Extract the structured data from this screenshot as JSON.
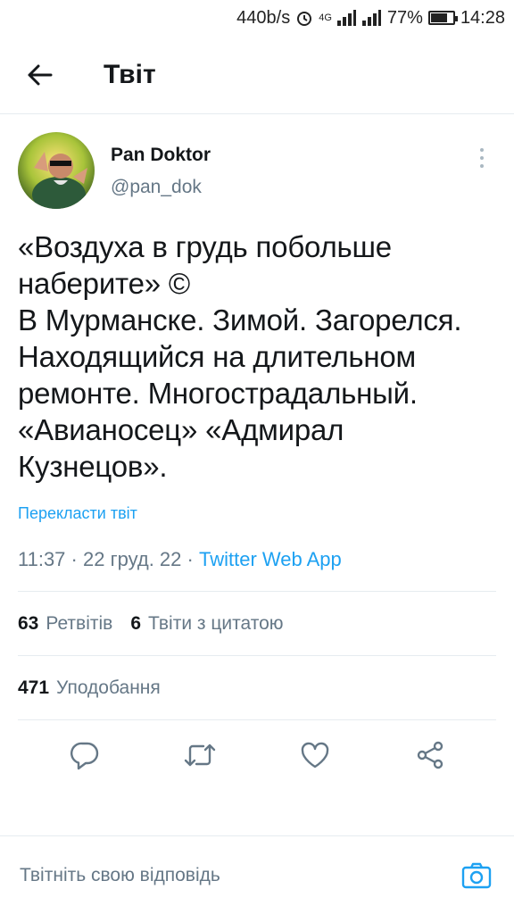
{
  "status_bar": {
    "speed": "440b/s",
    "network": "4G",
    "battery_percent": "77%",
    "battery_level": 0.77,
    "time": "14:28"
  },
  "header": {
    "title": "Твіт"
  },
  "tweet": {
    "author": {
      "display_name": "Pan Doktor",
      "handle": "@pan_dok"
    },
    "text": "«Воздуха в грудь побольше наберите» ©\nВ Мурманске. Зимой. Загорелся. Находящийся на длительном ремонте. Многострадальный. «Авианосец» «Адмирал Кузнецов».",
    "translate_label": "Перекласти твіт",
    "time": "11:37",
    "date": "22 груд. 22",
    "separator": "·",
    "source": "Twitter Web App",
    "stats": {
      "retweets_count": "63",
      "retweets_label": "Ретвітів",
      "quotes_count": "6",
      "quotes_label": "Твіти з цитатою",
      "likes_count": "471",
      "likes_label": "Уподобання"
    }
  },
  "reply": {
    "placeholder": "Твітніть свою відповідь"
  },
  "colors": {
    "accent": "#1da1f2",
    "secondary_text": "#657786",
    "primary_text": "#14171a",
    "divider": "#e6ecf0"
  }
}
